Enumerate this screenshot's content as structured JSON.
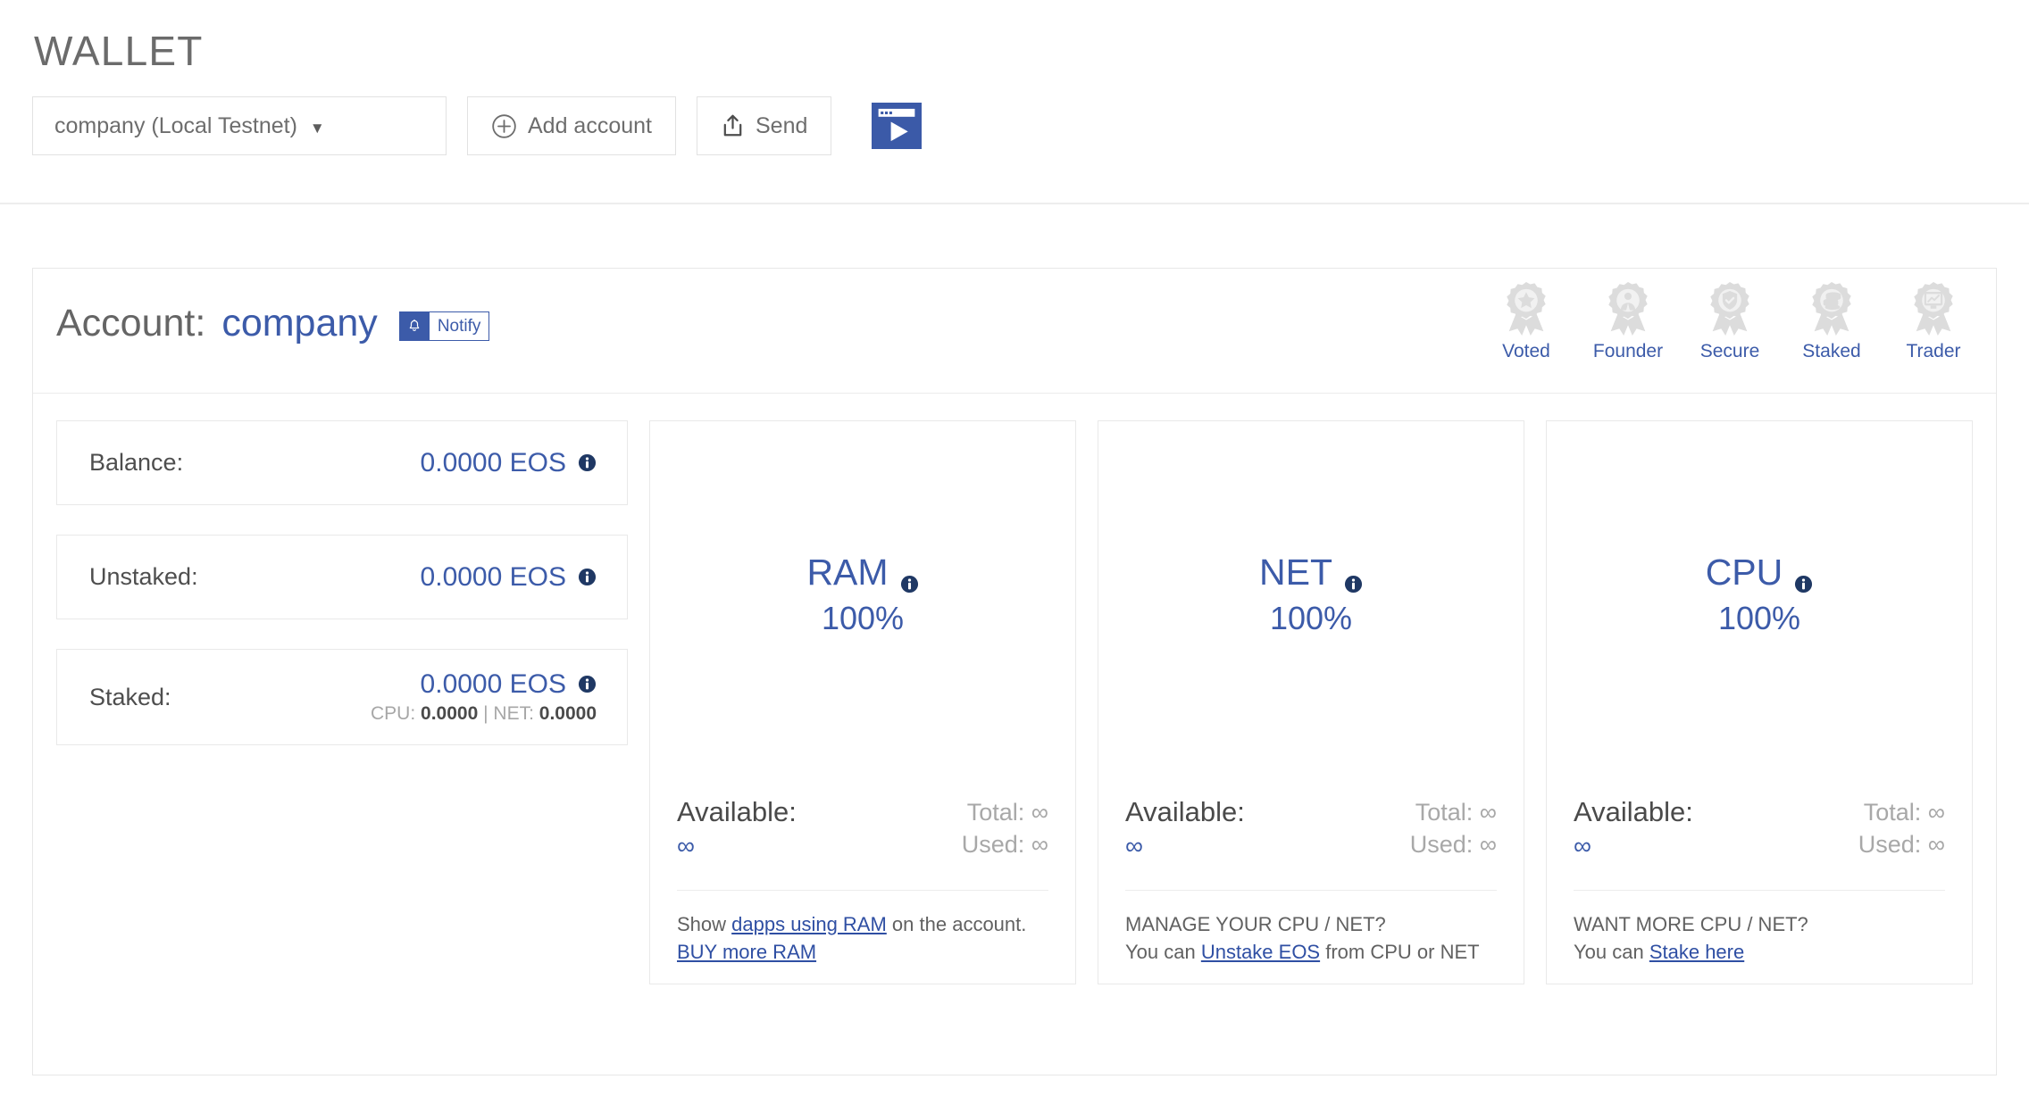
{
  "header": {
    "title": "WALLET",
    "toolbar": {
      "account_select_value": "company (Local Testnet)",
      "add_account_label": "Add account",
      "send_label": "Send",
      "video_icon": "video-play-icon"
    }
  },
  "account": {
    "label": "Account:",
    "name": "company",
    "notify_label": "Notify",
    "notify_icon": "bell-icon"
  },
  "badges": [
    {
      "label": "Voted",
      "icon": "medal-star-icon"
    },
    {
      "label": "Founder",
      "icon": "medal-person-icon"
    },
    {
      "label": "Secure",
      "icon": "medal-shield-icon"
    },
    {
      "label": "Staked",
      "icon": "medal-coins-icon"
    },
    {
      "label": "Trader",
      "icon": "medal-chart-icon"
    }
  ],
  "stats": [
    {
      "label": "Balance:",
      "value": "0.0000 EOS",
      "sub": null
    },
    {
      "label": "Unstaked:",
      "value": "0.0000 EOS",
      "sub": null
    },
    {
      "label": "Staked:",
      "value": "0.0000 EOS",
      "sub_cpu_label": "CPU:",
      "sub_cpu_value": "0.0000",
      "sub_sep": "|",
      "sub_net_label": "NET:",
      "sub_net_value": "0.0000"
    }
  ],
  "resources": [
    {
      "title": "RAM",
      "percent": "100%",
      "available_label": "Available:",
      "available_value": "∞",
      "total_label": "Total: ∞",
      "used_label": "Used: ∞",
      "foot_line1_pre": "Show ",
      "foot_line1_link": "dapps using RAM",
      "foot_line1_post": " on the account.",
      "foot_line2_link": "BUY more RAM",
      "foot_line2_pre": "",
      "foot_line2_post": ""
    },
    {
      "title": "NET",
      "percent": "100%",
      "available_label": "Available:",
      "available_value": "∞",
      "total_label": "Total: ∞",
      "used_label": "Used: ∞",
      "foot_line1_pre": "MANAGE YOUR CPU / NET?",
      "foot_line1_link": "",
      "foot_line1_post": "",
      "foot_line2_pre": "You can ",
      "foot_line2_link": "Unstake EOS",
      "foot_line2_post": " from CPU or NET"
    },
    {
      "title": "CPU",
      "percent": "100%",
      "available_label": "Available:",
      "available_value": "∞",
      "total_label": "Total: ∞",
      "used_label": "Used: ∞",
      "foot_line1_pre": "WANT MORE CPU / NET?",
      "foot_line1_link": "",
      "foot_line1_post": "",
      "foot_line2_pre": "You can ",
      "foot_line2_link": "Stake here",
      "foot_line2_post": ""
    }
  ],
  "colors": {
    "brand_blue": "#3c5ba9",
    "link_blue": "#2f4fa3",
    "info_navy": "#1f3864",
    "text_gray": "#6b6b6b",
    "muted_gray": "#a8a8a8",
    "border_gray": "#e9e9e9",
    "badge_gray": "#dcdcdc"
  }
}
